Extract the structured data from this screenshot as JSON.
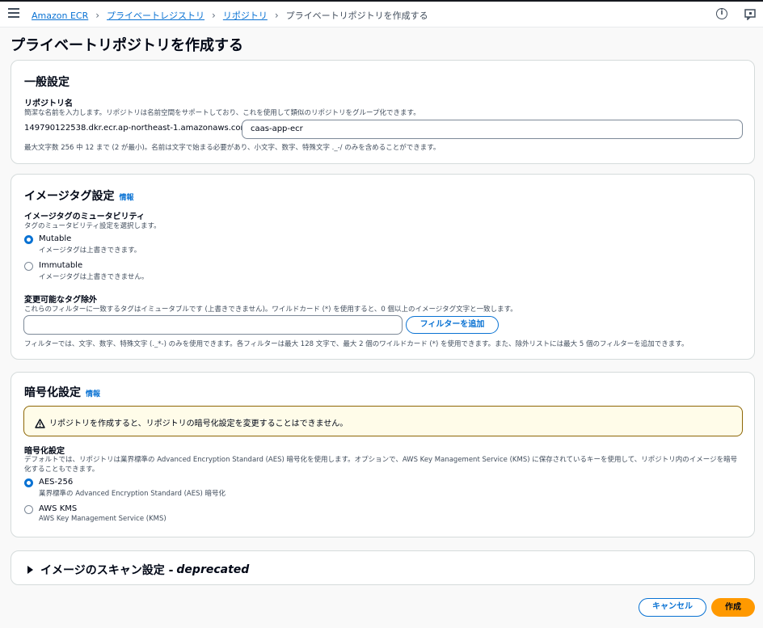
{
  "breadcrumb": {
    "items": [
      "Amazon ECR",
      "プライベートレジストリ",
      "リポジトリ"
    ],
    "current": "プライベートリポジトリを作成する"
  },
  "page_title": "プライベートリポジトリを作成する",
  "general": {
    "title": "一般設定",
    "repo_label": "リポジトリ名",
    "repo_desc": "簡潔な名前を入力します。リポジトリは名前空間をサポートしており、これを使用して類似のリポジトリをグループ化できます。",
    "repo_prefix": "149790122538.dkr.ecr.ap-northeast-1.amazonaws.com/",
    "repo_value": "caas-app-ecr",
    "repo_hint": "最大文字数 256 中 12 まで (2 が最小)。名前は文字で始まる必要があり、小文字、数字、特殊文字 ._-/ のみを含めることができます。"
  },
  "image_tag": {
    "title": "イメージタグ設定",
    "info": "情報",
    "mutability_label": "イメージタグのミュータビリティ",
    "mutability_desc": "タグのミュータビリティ設定を選択します。",
    "options": [
      {
        "label": "Mutable",
        "desc": "イメージタグは上書きできます。",
        "checked": true
      },
      {
        "label": "Immutable",
        "desc": "イメージタグは上書きできません。",
        "checked": false
      }
    ],
    "exclusion_label": "変更可能なタグ除外",
    "exclusion_desc": "これらのフィルターに一致するタグはイミュータブルです (上書きできません)。ワイルドカード (*) を使用すると、0 個以上のイメージタグ文字と一致します。",
    "filter_value": "",
    "add_filter_button": "フィルターを追加",
    "filter_hint": "フィルターでは、文字、数字、特殊文字 (._*-) のみを使用できます。各フィルターは最大 128 文字で、最大 2 個のワイルドカード (*) を使用できます。また、除外リストには最大 5 個のフィルターを追加できます。"
  },
  "encryption": {
    "title": "暗号化設定",
    "info": "情報",
    "alert": "リポジトリを作成すると、リポジトリの暗号化設定を変更することはできません。",
    "label": "暗号化設定",
    "desc": "デフォルトでは、リポジトリは業界標準の Advanced Encryption Standard (AES) 暗号化を使用します。オプションで、AWS Key Management Service (KMS) に保存されているキーを使用して、リポジトリ内のイメージを暗号化することもできます。",
    "options": [
      {
        "label": "AES-256",
        "desc": "業界標準の Advanced Encryption Standard (AES) 暗号化",
        "checked": true
      },
      {
        "label": "AWS KMS",
        "desc": "AWS Key Management Service (KMS)",
        "checked": false
      }
    ]
  },
  "scan": {
    "title": "イメージのスキャン設定 - ",
    "title_em": "deprecated"
  },
  "footer": {
    "cancel": "キャンセル",
    "create": "作成"
  },
  "icons": [
    "menu-icon",
    "chevron-right-icon",
    "info-icon",
    "feedback-icon",
    "warning-icon",
    "caret-right-icon"
  ],
  "colors": {
    "accent": "#0972d3",
    "primary_button": "#ff9900",
    "warning_bg": "#fffce9",
    "warning_border": "#8d6605"
  }
}
